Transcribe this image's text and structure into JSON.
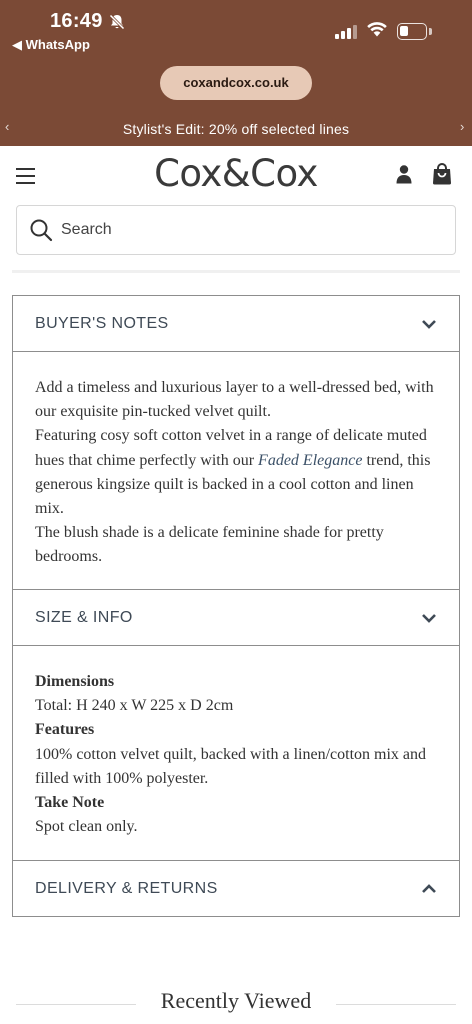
{
  "status_bar": {
    "time": "16:49",
    "back_app": "◀ WhatsApp"
  },
  "browser": {
    "url": "coxandcox.co.uk",
    "promo_prev": "‹",
    "promo_text": "Stylist's Edit: 20% off selected lines",
    "promo_next": "›"
  },
  "header": {
    "logo": "Cox&Cox",
    "menu_icon": "hamburger-icon",
    "account_icon": "account-icon",
    "bag_icon": "shopping-bag-icon"
  },
  "search": {
    "placeholder": "Search"
  },
  "accordion": {
    "buyers_notes": {
      "title": "BUYER'S NOTES",
      "para1": "Add a timeless and luxurious layer to a well-dressed bed, with our exquisite pin-tucked velvet quilt.",
      "para2_before": "Featuring cosy soft cotton velvet in a range of delicate muted hues that chime perfectly with our ",
      "para2_link": "Faded Elegance",
      "para2_after": " trend, this generous kingsize quilt is backed in a cool cotton and linen mix.",
      "para3": "The blush shade is a delicate feminine shade for pretty bedrooms."
    },
    "size_info": {
      "title": "SIZE & INFO",
      "dimensions_heading": "Dimensions",
      "dimensions_value": "Total: H 240 x W 225 x D 2cm",
      "features_heading": "Features",
      "features_value": "100% cotton velvet quilt, backed with a linen/cotton mix and filled with 100% polyester.",
      "note_heading": "Take Note",
      "note_value": "Spot clean only."
    },
    "delivery": {
      "title": "DELIVERY & RETURNS"
    }
  },
  "recently_viewed": {
    "title": "Recently Viewed"
  },
  "colors": {
    "chrome_bg": "#7b4a36",
    "url_pill": "#e7c9b6",
    "heading_text": "#3f4a56",
    "link_italic": "#3b5067"
  }
}
